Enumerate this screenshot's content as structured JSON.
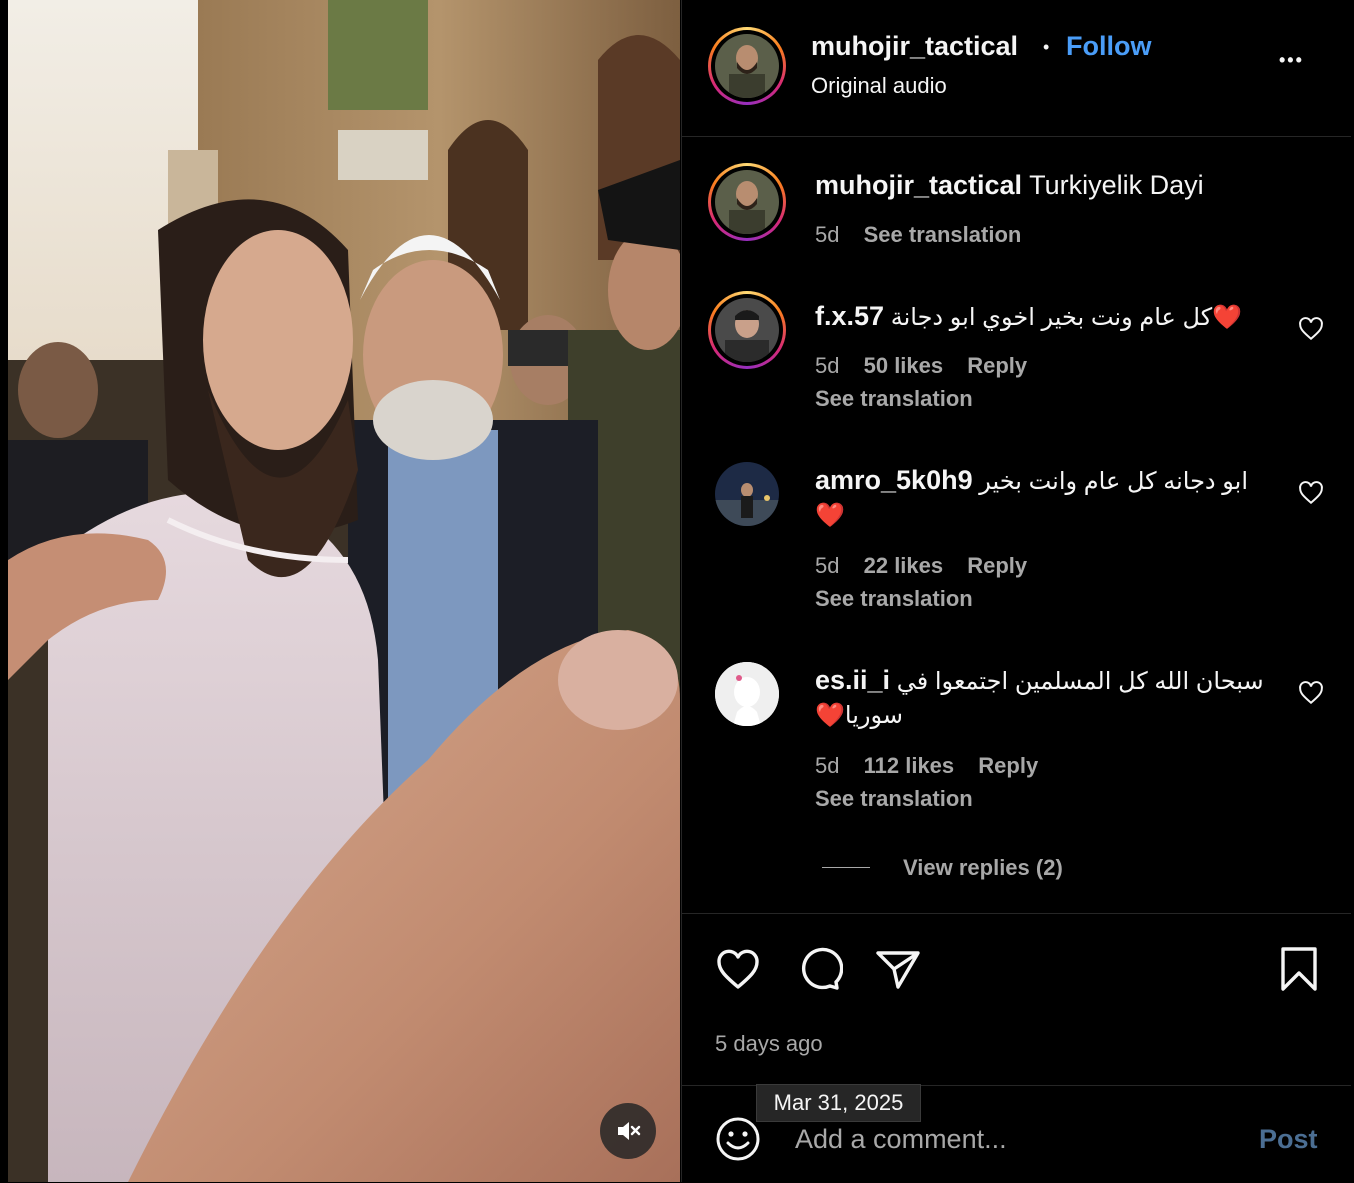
{
  "post": {
    "username": "muhojir_tactical",
    "follow_label": "Follow",
    "separator": "•",
    "audio": "Original audio",
    "more_label": "•••"
  },
  "caption": {
    "username": "muhojir_tactical",
    "text": "Turkiyelik Dayi",
    "age": "5d",
    "see_translation": "See translation"
  },
  "comments": [
    {
      "username": "f.x.57",
      "text": "كل عام ونت بخير اخوي ابو دجانة❤️",
      "age": "5d",
      "likes": "50 likes",
      "reply": "Reply",
      "see_translation": "See translation"
    },
    {
      "username": "amro_5k0h9",
      "text": "ابو دجانه كل عام وانت بخير",
      "text2": "❤️",
      "age": "5d",
      "likes": "22 likes",
      "reply": "Reply",
      "see_translation": "See translation"
    },
    {
      "username": "es.ii_i",
      "text": "سبحان الله كل المسلمين اجتمعوا في",
      "text2": "❤️سوريا",
      "age": "5d",
      "likes": "112 likes",
      "reply": "Reply",
      "see_translation": "See translation"
    }
  ],
  "view_replies": "View replies (2)",
  "timestamp": "5 days ago",
  "tooltip_date": "Mar 31, 2025",
  "add_comment": {
    "placeholder": "Add a comment...",
    "post_label": "Post"
  },
  "icons": {
    "like": "heart-icon",
    "comment": "comment-bubble-icon",
    "share": "paper-plane-icon",
    "save": "bookmark-icon",
    "emoji": "emoji-icon",
    "mute": "speaker-muted-icon"
  },
  "colors": {
    "follow": "#4a9df8",
    "muted_text": "#a8a8a8",
    "background": "#000000",
    "post_label": "#4b6e93"
  }
}
